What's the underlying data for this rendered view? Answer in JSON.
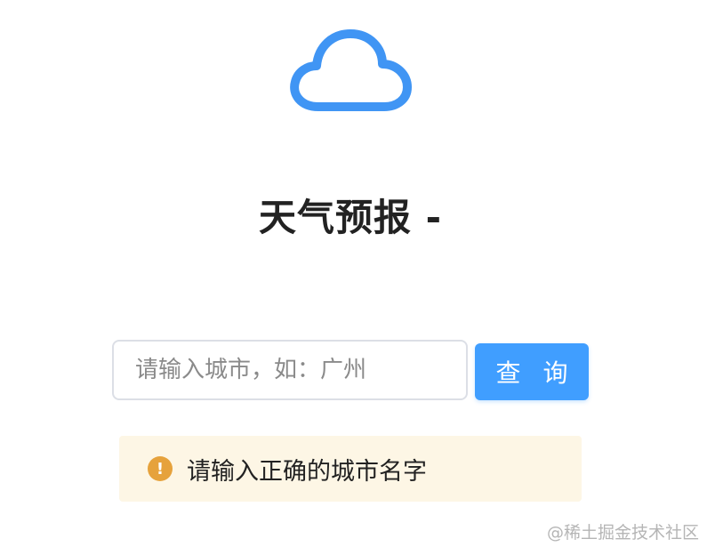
{
  "header": {
    "logo_icon": "cloud-icon",
    "logo_color": "#4095f4",
    "title": "天气预报 -"
  },
  "search": {
    "placeholder": "请输入城市，如：广州",
    "value": "",
    "button_label": "查 询",
    "button_color": "#409eff"
  },
  "alert": {
    "icon": "warning-icon",
    "icon_glyph": "!",
    "icon_color": "#e6a23c",
    "background": "#fdf6e5",
    "message": "请输入正确的城市名字"
  },
  "watermark": {
    "text": "@稀土掘金技术社区"
  }
}
